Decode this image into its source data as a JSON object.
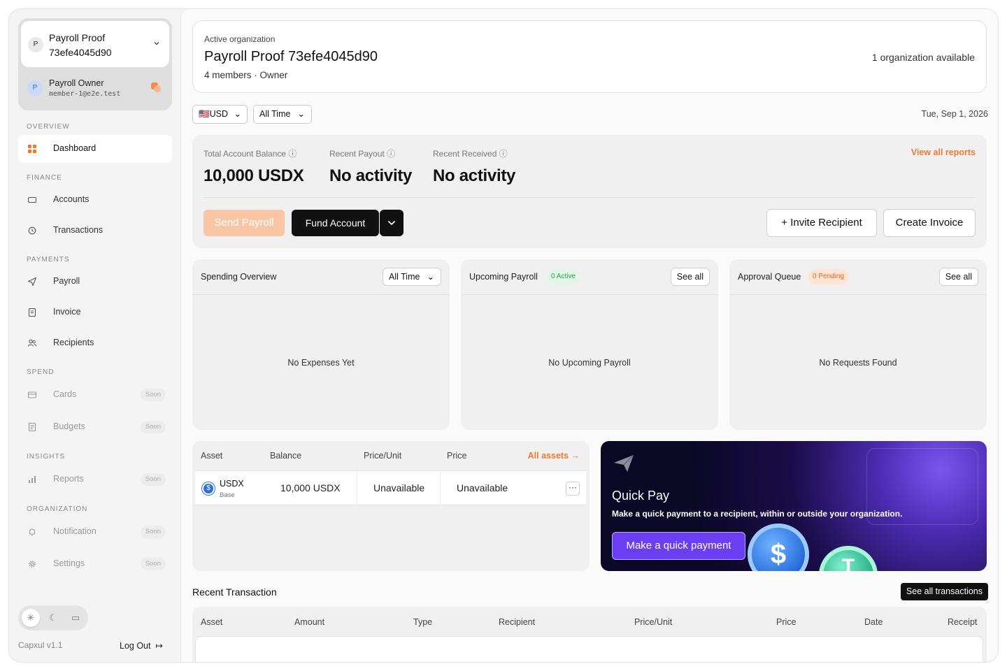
{
  "org": {
    "avatar": "P",
    "name": "Payroll Proof 73efe4045d90",
    "user_avatar": "P",
    "user_name": "Payroll Owner",
    "user_email": "member-1@e2e.test"
  },
  "nav": {
    "overview_label": "OVERVIEW",
    "finance_label": "FINANCE",
    "payments_label": "PAYMENTS",
    "spend_label": "SPEND",
    "insights_label": "INSIGHTS",
    "organization_label": "ORGANIZATION",
    "soon_label": "Soon",
    "items": {
      "dashboard": "Dashboard",
      "accounts": "Accounts",
      "transactions": "Transactions",
      "payroll": "Payroll",
      "invoice": "Invoice",
      "recipients": "Recipients",
      "cards": "Cards",
      "budgets": "Budgets",
      "reports": "Reports",
      "notification": "Notification",
      "settings": "Settings"
    }
  },
  "footer": {
    "version": "Capxul v1.1",
    "logout": "Log Out"
  },
  "header": {
    "kicker": "Active organization",
    "title": "Payroll Proof 73efe4045d90",
    "subtitle": "4 members · Owner",
    "available": "1 organization available"
  },
  "filters": {
    "currency": "USD",
    "currency_flag": "🇺🇸",
    "period": "All Time",
    "date": "Tue, Sep 1, 2026"
  },
  "balance": {
    "total_label": "Total Account Balance",
    "total_value": "10,000 USDX",
    "payout_label": "Recent Payout",
    "payout_value": "No activity",
    "received_label": "Recent Received",
    "received_value": "No activity",
    "view_all": "View all reports",
    "send": "Send Payroll",
    "fund": "Fund Account",
    "invite": "Invite Recipient",
    "create_invoice": "Create Invoice"
  },
  "cards": {
    "spending": {
      "title": "Spending Overview",
      "filter": "All Time",
      "empty": "No Expenses Yet"
    },
    "upcoming": {
      "title": "Upcoming Payroll",
      "pill": "0 Active",
      "btn": "See all",
      "empty": "No Upcoming Payroll"
    },
    "approval": {
      "title": "Approval Queue",
      "pill": "0 Pending",
      "btn": "See all",
      "empty": "No Requests Found"
    }
  },
  "assets": {
    "headers": [
      "Asset",
      "Balance",
      "Price/Unit",
      "Price"
    ],
    "all_assets": "All assets",
    "row": {
      "symbol": "USDX",
      "network": "Base",
      "balance": "10,000 USDX",
      "price_unit": "Unavailable",
      "price": "Unavailable"
    }
  },
  "quickpay": {
    "title": "Quick Pay",
    "desc": "Make a quick payment to a recipient, within or outside your organization.",
    "cta": "Make a quick payment"
  },
  "recent": {
    "title": "Recent Transaction",
    "see_all": "See all transactions",
    "headers": [
      "Asset",
      "Amount",
      "Type",
      "Recipient",
      "Price/Unit",
      "Price",
      "Date",
      "Receipt"
    ]
  },
  "colors": {
    "accent": "#ef7a2c",
    "primary_dark": "#111111",
    "quick_pay_button": "#6a3ff2",
    "active_green": "#2aa05a",
    "pending_orange": "#e4671f"
  }
}
